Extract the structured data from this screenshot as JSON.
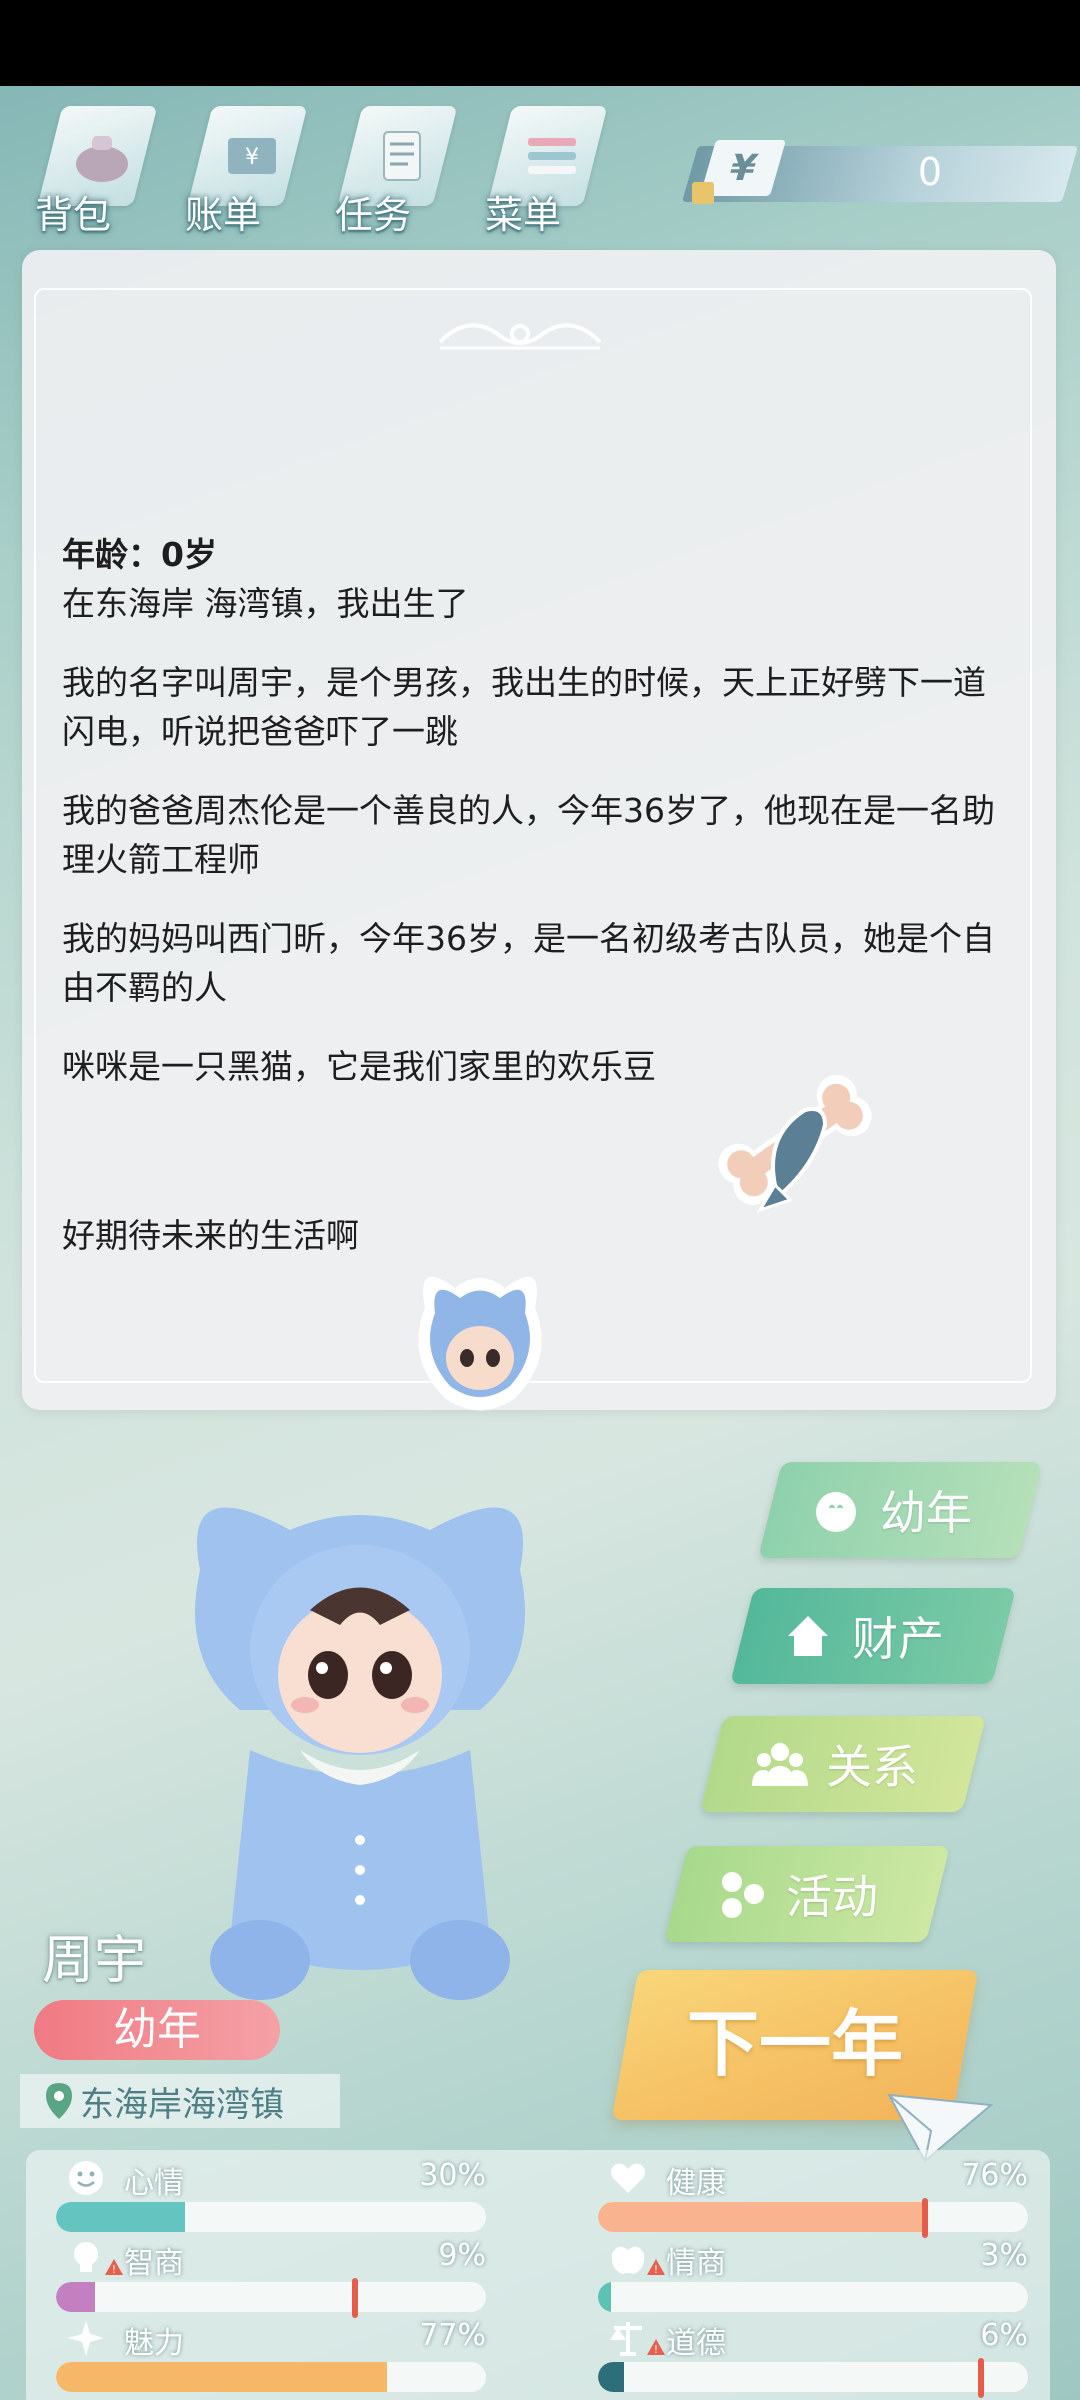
{
  "top_menu": [
    {
      "label": "背包",
      "icon": "backpack-icon"
    },
    {
      "label": "账单",
      "icon": "bill-icon"
    },
    {
      "label": "任务",
      "icon": "task-icon"
    },
    {
      "label": "菜单",
      "icon": "menu-icon"
    }
  ],
  "money": {
    "symbol": "¥",
    "value": "0"
  },
  "story": {
    "age": "年龄：0岁",
    "paragraphs": [
      "在东海岸 海湾镇，我出生了",
      "我的名字叫周宇，是个男孩，我出生的时候，天上正好劈下一道闪电，听说把爸爸吓了一跳",
      "我的爸爸周杰伦是一个善良的人，今年36岁了，他现在是一名助理火箭工程师",
      "我的妈妈叫西门昕，今年36岁，是一名初级考古队员，她是个自由不羁的人",
      "咪咪是一只黑猫，它是我们家里的欢乐豆",
      "好期待未来的生活啊"
    ]
  },
  "side_buttons": {
    "stage": "幼年",
    "assets": "财产",
    "relations": "关系",
    "activities": "活动"
  },
  "next_year": "下一年",
  "character": {
    "name": "周宇",
    "stage": "幼年",
    "location": "东海岸海湾镇"
  },
  "stats": [
    {
      "name": "心情",
      "pct": "30%",
      "value": 0.3,
      "color": "#63c4c0",
      "icon": "smiley-icon",
      "warn": false
    },
    {
      "name": "健康",
      "pct": "76%",
      "value": 0.76,
      "color": "#f9b48f",
      "icon": "heart-icon",
      "warn": false
    },
    {
      "name": "智商",
      "pct": "9%",
      "value": 0.09,
      "color": "#c37fbf",
      "icon": "bulb-icon",
      "warn": true
    },
    {
      "name": "情商",
      "pct": "3%",
      "value": 0.03,
      "color": "#5cc2b4",
      "icon": "apple-icon",
      "warn": true
    },
    {
      "name": "魅力",
      "pct": "77%",
      "value": 0.77,
      "color": "#f7b768",
      "icon": "sparkle-icon",
      "warn": false
    },
    {
      "name": "道德",
      "pct": "6%",
      "value": 0.06,
      "color": "#2c6e7a",
      "icon": "scale-icon",
      "warn": true
    }
  ]
}
